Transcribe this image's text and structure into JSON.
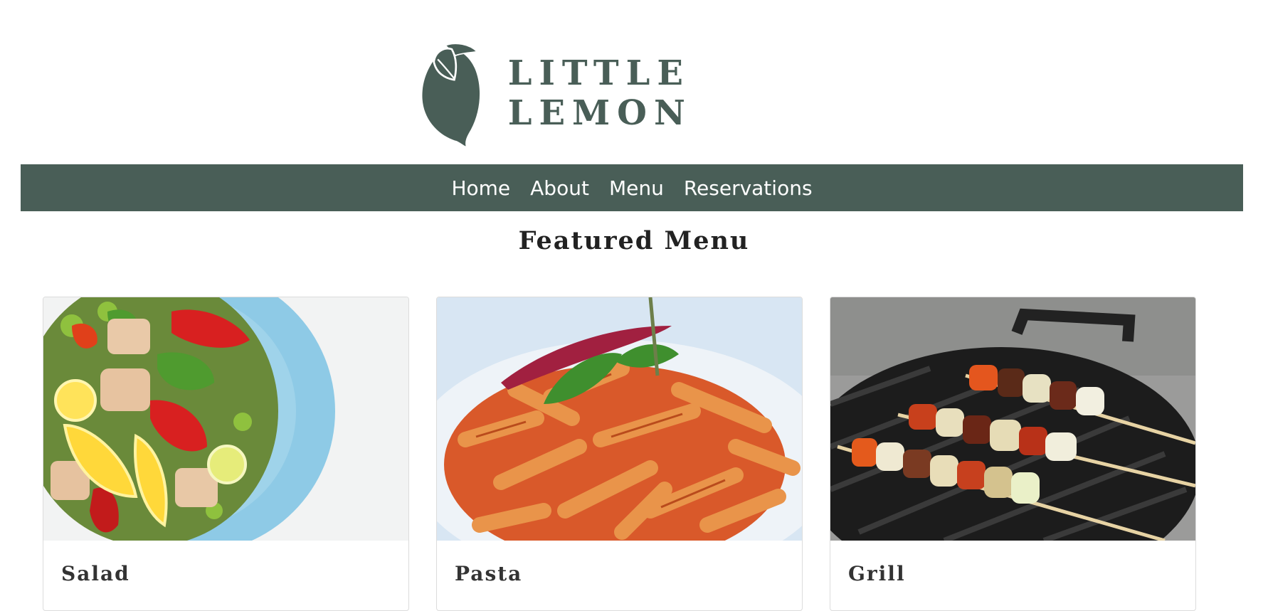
{
  "brand": {
    "name": "LITTLE LEMON",
    "logo_icon": "lemon-icon",
    "color": "#495e57"
  },
  "nav": {
    "items": [
      {
        "label": "Home"
      },
      {
        "label": "About"
      },
      {
        "label": "Menu"
      },
      {
        "label": "Reservations"
      }
    ],
    "background": "#495e57"
  },
  "featured": {
    "title": "Featured Menu",
    "cards": [
      {
        "name": "Salad",
        "image": "salad-photo"
      },
      {
        "name": "Pasta",
        "image": "pasta-photo"
      },
      {
        "name": "Grill",
        "image": "grill-photo"
      }
    ]
  }
}
